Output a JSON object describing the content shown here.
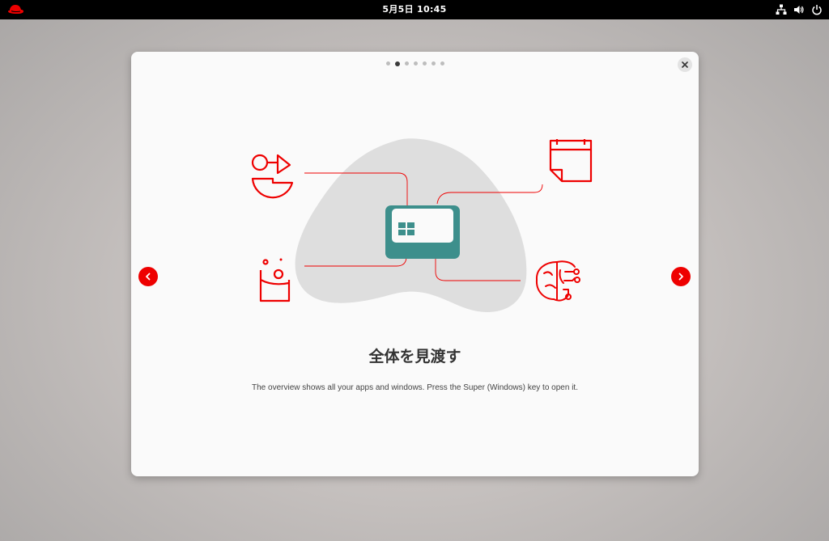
{
  "topbar": {
    "clock": "5月5日  10:45",
    "icons": [
      "redhat-logo-icon",
      "network-icon",
      "volume-icon",
      "power-icon"
    ]
  },
  "tour": {
    "page_count": 7,
    "current_page": 2,
    "title": "全体を見渡す",
    "description": "The overview shows all your apps and windows. Press the Super (Windows) key to open it.",
    "close_icon": "close-icon",
    "prev_icon": "chevron-left-icon",
    "next_icon": "chevron-right-icon"
  },
  "colors": {
    "accent": "#ee0000",
    "teal": "#3d8f8c",
    "blob": "#dedede",
    "dialog_bg": "#fafafa"
  }
}
